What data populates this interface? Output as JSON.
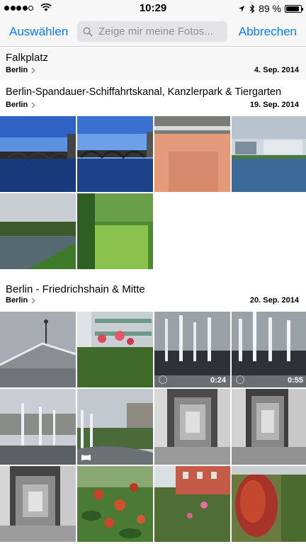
{
  "status": {
    "time": "10:29",
    "battery": "89 %",
    "battery_level": 0.89
  },
  "nav": {
    "select_label": "Auswählen",
    "search_placeholder": "Zeige mir meine Fotos...",
    "cancel_label": "Abbrechen"
  },
  "sections": [
    {
      "title": "Falkplatz",
      "subtitle": "Berlin",
      "date": "4. Sep. 2014"
    },
    {
      "title": "Berlin-Spandauer-Schiffahrtskanal, Kanzlerpark & Tiergarten",
      "subtitle": "Berlin",
      "date": "19. Sep. 2014"
    },
    {
      "title": "Berlin - Friedrichshain & Mitte",
      "subtitle": "Berlin",
      "date": "20. Sep. 2014"
    }
  ],
  "videos": [
    "0:24",
    "0:55"
  ],
  "colors": {
    "accent": "#0a7aff",
    "bar_bg": "#f7f7f7"
  }
}
